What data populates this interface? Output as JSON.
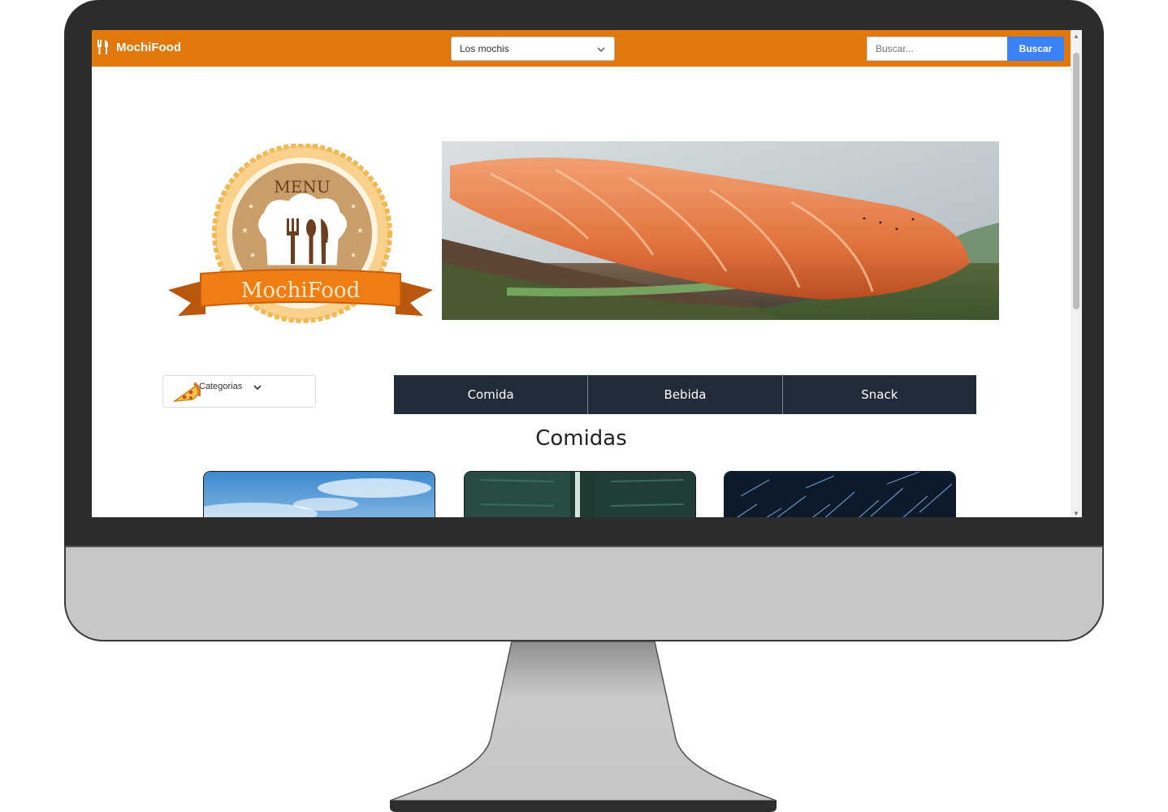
{
  "navbar": {
    "brand": "MochiFood",
    "location_value": "Los mochis",
    "search_placeholder": "Buscar...",
    "search_button": "Buscar",
    "color": "#e0780b"
  },
  "logo": {
    "top_text": "MENU",
    "ribbon_text": "MochiFood"
  },
  "categories": {
    "label": "Categorias"
  },
  "tabs": [
    "Comida",
    "Bebida",
    "Snack"
  ],
  "section_title": "Comidas",
  "icons": [
    "utensils-icon",
    "chevron-down-icon",
    "pizza-icon",
    "scroll-up-icon",
    "scroll-down-icon"
  ]
}
